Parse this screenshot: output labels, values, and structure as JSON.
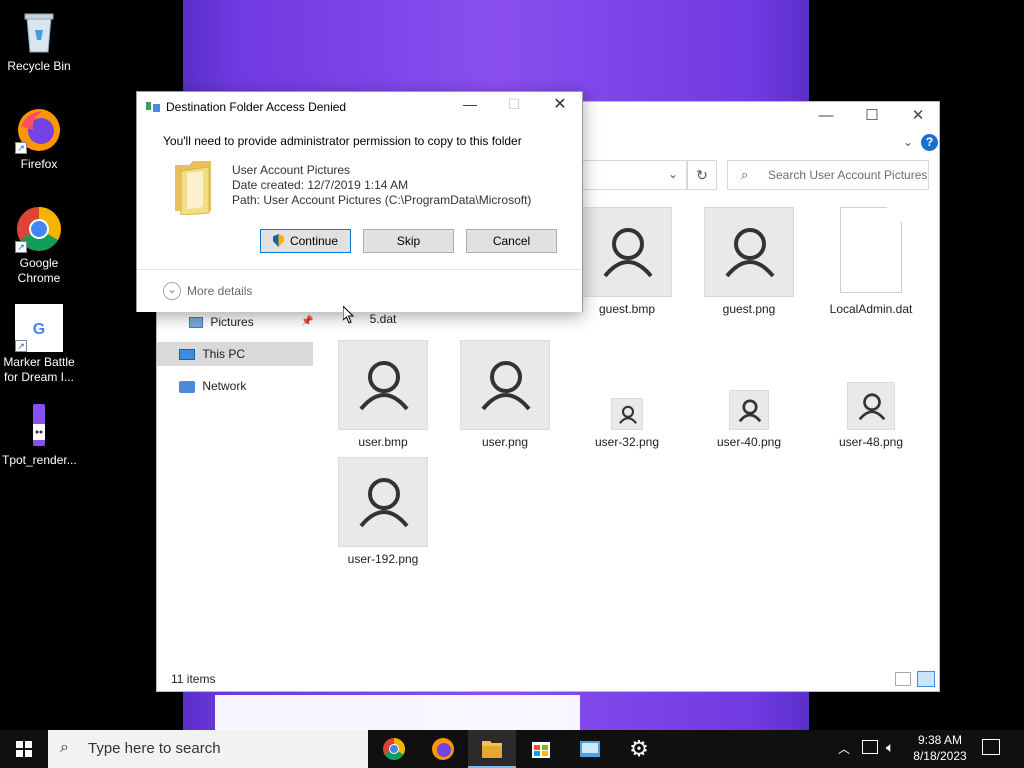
{
  "desktop": {
    "icons": [
      {
        "label": "Recycle Bin"
      },
      {
        "label": "Firefox"
      },
      {
        "label": "Google Chrome"
      },
      {
        "label": "Marker Battle for Dream I..."
      },
      {
        "label": "Tpot_render..."
      }
    ]
  },
  "explorer": {
    "search_placeholder": "Search User Account Pictures",
    "nav": {
      "pictures": "Pictures",
      "this_pc": "This PC",
      "network": "Network"
    },
    "files": [
      {
        "name": "5.dat"
      },
      {
        "name": "guest.bmp"
      },
      {
        "name": "guest.png"
      },
      {
        "name": "LocalAdmin.dat"
      },
      {
        "name": "user.bmp"
      },
      {
        "name": "user.png"
      },
      {
        "name": "user-32.png"
      },
      {
        "name": "user-40.png"
      },
      {
        "name": "user-48.png"
      },
      {
        "name": "user-192.png"
      }
    ],
    "status": "11 items"
  },
  "dialog": {
    "title": "Destination Folder Access Denied",
    "message": "You'll need to provide administrator permission to copy to this folder",
    "folder_name": "User Account Pictures",
    "date_created": "Date created: 12/7/2019 1:14 AM",
    "path": "Path: User Account Pictures (C:\\ProgramData\\Microsoft)",
    "buttons": {
      "continue": "Continue",
      "skip": "Skip",
      "cancel": "Cancel"
    },
    "more_details": "More details"
  },
  "taskbar": {
    "search_placeholder": "Type here to search",
    "time": "9:38 AM",
    "date": "8/18/2023"
  },
  "colors": {
    "accent": "#0078d7",
    "wallpaper": "#7a45e6",
    "taskbar": "#101010"
  }
}
